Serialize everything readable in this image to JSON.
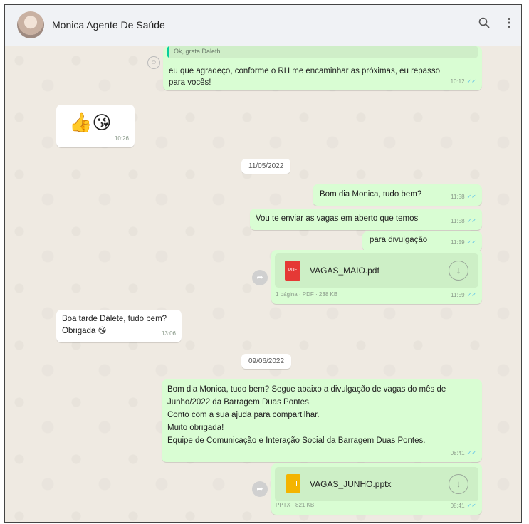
{
  "header": {
    "contact_name": "Monica Agente De Saúde",
    "search_icon": "search-icon",
    "menu_icon": "menu-icon"
  },
  "messages": {
    "m1_quote": "Ok, grata Daleth",
    "m1_line1": "eu que agradeço, conforme o RH me encaminhar as próximas, eu repasso",
    "m1_line2": "para vocês!",
    "m1_time": "10:12",
    "m2_emoji": "👍😘",
    "m2_time": "10:26",
    "date1": "11/05/2022",
    "m3_text": "Bom dia Monica, tudo bem?",
    "m3_time": "11:58",
    "m4_text": "Vou te enviar as vagas em aberto que temos",
    "m4_time": "11:58",
    "m5_text": "para divulgação",
    "m5_time": "11:59",
    "f1_name": "VAGAS_MAIO.pdf",
    "f1_icon_label": "PDF",
    "f1_meta": "1 página · PDF · 238 KB",
    "f1_time": "11:59",
    "m6_line1": "Boa tarde Dálete, tudo bem?",
    "m6_line2": "Obrigada 😘",
    "m6_time": "13:06",
    "date2": "09/06/2022",
    "m7_line1": "Bom dia Monica, tudo bem? Segue abaixo a divulgação de vagas do mês de",
    "m7_line2": "Junho/2022 da Barragem Duas Pontes.",
    "m7_line3": "Conto com a sua ajuda para compartilhar.",
    "m7_line4": "Muito obrigada!",
    "m7_line5": "Equipe de Comunicação e Interação Social da Barragem Duas Pontes.",
    "m7_time": "08:41",
    "f2_name": "VAGAS_JUNHO.pptx",
    "f2_meta": "PPTX · 821 KB",
    "f2_time": "08:41",
    "ticks": "✓✓"
  },
  "colors": {
    "outgoing": "#d9fdd3",
    "incoming": "#ffffff",
    "read_ticks": "#53bdeb",
    "pdf": "#e53935",
    "pptx": "#f4b400"
  }
}
